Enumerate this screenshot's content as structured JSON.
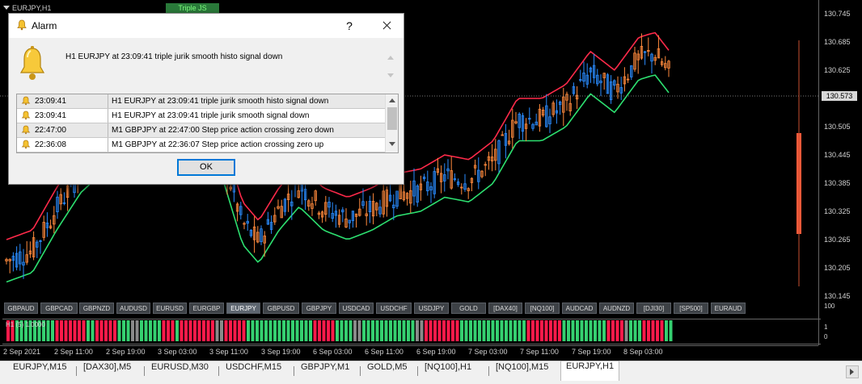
{
  "chart": {
    "title": "EURJPY,H1",
    "indicator_label": "Triple JS",
    "price_ticks": [
      "130.745",
      "130.685",
      "130.625",
      "130.565",
      "130.505",
      "130.445",
      "130.385",
      "130.325",
      "130.265",
      "130.205",
      "130.145"
    ],
    "current_price": "130.573",
    "colors": {
      "bull": "#ff8a3d",
      "bear": "#2a8cff",
      "upper_line": "#ff2a4a",
      "lower_line": "#2de070",
      "volume_bar": "#ff5a3a"
    }
  },
  "symbol_bar": {
    "items": [
      "GBPAUD",
      "GBPCAD",
      "GBPNZD",
      "AUDUSD",
      "EURUSD",
      "EURGBP",
      "EURJPY",
      "GBPUSD",
      "GBPJPY",
      "USDCAD",
      "USDCHF",
      "USDJPY",
      "GOLD",
      "[DAX40]",
      "[NQ100]",
      "AUDCAD",
      "AUDNZD",
      "[DJI30]",
      "[SP500]",
      "EURAUD"
    ],
    "active": "EURJPY"
  },
  "sub_window": {
    "label": "H1 (5) 1.0000",
    "axis_labels": [
      "100",
      "1",
      "0"
    ],
    "pattern": "RRGGGGGGGGGRRRRRRRGGRRRRRGGGYYGGGGGRRRGRRRRRRRRYYRRRRRGGGGGGGGGGGGGGGRRRRRGGGGYYGGGGGGGGGGGGYYRRRRRRRRGGGGGGGGGGGGGGGRRRRRRRRGGGGGGGGGGRRRRYGGGRRRRRGGGG"
  },
  "time_axis": [
    "2 Sep 2021",
    "2 Sep 11:00",
    "2 Sep 19:00",
    "3 Sep 03:00",
    "3 Sep 11:00",
    "3 Sep 19:00",
    "6 Sep 03:00",
    "6 Sep 11:00",
    "6 Sep 19:00",
    "7 Sep 03:00",
    "7 Sep 11:00",
    "7 Sep 19:00",
    "8 Sep 03:00"
  ],
  "tabs": {
    "items": [
      "EURJPY,M15",
      "[DAX30],M5",
      "EURUSD,M30",
      "USDCHF,M15",
      "GBPJPY,M1",
      "GOLD,M5",
      "[NQ100],H1",
      "[NQ100],M15",
      "EURJPY,H1"
    ],
    "active": "EURJPY,H1"
  },
  "dialog": {
    "title": "Alarm",
    "help_label": "?",
    "message": "H1 EURJPY at 23:09:41  triple jurik smooth histo  signal down",
    "rows": [
      {
        "time": "23:09:41",
        "message": "H1 EURJPY at 23:09:41  triple jurik smooth histo  signal down"
      },
      {
        "time": "23:09:41",
        "message": "H1 EURJPY at 23:09:41  triple jurik smooth  signal down"
      },
      {
        "time": "22:47:00",
        "message": "M1 GBPJPY at 22:47:00 Step price action  crossing zero down"
      },
      {
        "time": "22:36:08",
        "message": "M1 GBPJPY at 22:36:07 Step price action  crossing zero up"
      }
    ],
    "ok_label": "OK"
  }
}
